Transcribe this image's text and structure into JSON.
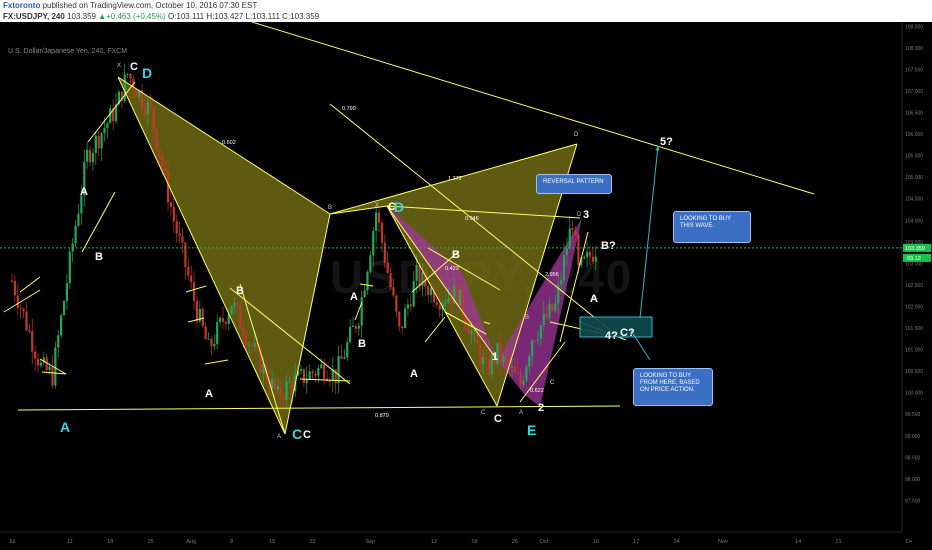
{
  "header": {
    "author": "Fxtoronto",
    "published": "published on TradingView.com, October 10, 2016 07:30 EST",
    "symbol": "FX:USDJPY, 240",
    "last": "103.359",
    "change": "▲+0.463 (+0.45%)",
    "open": "O:103.111",
    "high": "H:103.427",
    "low": "L:103.111",
    "close": "C:103.359"
  },
  "chart_title": "U.S. Dollar/Japanese Yen, 240, FXCM",
  "watermark": "USDJPY, 240",
  "colors": {
    "background": "#000000",
    "up_candle": "#26a65b",
    "down_candle": "#c0392b",
    "trendline": "#ffff66",
    "pattern_fill": "#6e6a14",
    "pattern_fill_purple": "#a0369b",
    "price_line": "#19c14a",
    "arrow": "#35b6c8",
    "callout": "#3a6fc4"
  },
  "chart_data": {
    "type": "candlestick",
    "title": "U.S. Dollar/Japanese Yen, 240, FXCM",
    "xlabel": "",
    "ylabel": "",
    "ylim": [
      97.0,
      108.6
    ],
    "yticks": [
      "108.500",
      "108.000",
      "107.500",
      "107.000",
      "106.500",
      "106.000",
      "105.500",
      "105.000",
      "104.500",
      "104.000",
      "103.500",
      "103.000",
      "102.500",
      "102.000",
      "101.500",
      "101.000",
      "100.500",
      "100.000",
      "99.500",
      "99.000",
      "98.500",
      "98.000",
      "97.500"
    ],
    "xticks": [
      "Jul",
      "11",
      "18",
      "25",
      "Aug",
      "8",
      "15",
      "22",
      "Sep",
      "12",
      "19",
      "26",
      "Oct",
      "10",
      "17",
      "24",
      "Nov",
      "14",
      "21"
    ],
    "current_price": 103.359,
    "price_path": [
      {
        "date": "Jul 1",
        "price": 102.6
      },
      {
        "date": "Jul 6",
        "price": 100.6
      },
      {
        "date": "Jul 8",
        "price": 100.4
      },
      {
        "date": "Jul 12",
        "price": 103.9
      },
      {
        "date": "Jul 14",
        "price": 105.5
      },
      {
        "date": "Jul 19",
        "price": 106.6
      },
      {
        "date": "Jul 21",
        "price": 107.4
      },
      {
        "date": "Jul 25",
        "price": 106.5
      },
      {
        "date": "Jul 29",
        "price": 104.0
      },
      {
        "date": "Aug 2",
        "price": 101.9
      },
      {
        "date": "Aug 4",
        "price": 101.0
      },
      {
        "date": "Aug 8",
        "price": 102.1
      },
      {
        "date": "Aug 11",
        "price": 101.2
      },
      {
        "date": "Aug 16",
        "price": 99.9
      },
      {
        "date": "Aug 18",
        "price": 100.2
      },
      {
        "date": "Aug 24",
        "price": 100.6
      },
      {
        "date": "Aug 26",
        "price": 100.4
      },
      {
        "date": "Aug 30",
        "price": 101.8
      },
      {
        "date": "Sep 1",
        "price": 103.4
      },
      {
        "date": "Sep 2",
        "price": 104.2
      },
      {
        "date": "Sep 6",
        "price": 101.4
      },
      {
        "date": "Sep 9",
        "price": 102.7
      },
      {
        "date": "Sep 13",
        "price": 102.2
      },
      {
        "date": "Sep 16",
        "price": 102.3
      },
      {
        "date": "Sep 21",
        "price": 100.5
      },
      {
        "date": "Sep 23",
        "price": 100.9
      },
      {
        "date": "Sep 27",
        "price": 100.2
      },
      {
        "date": "Sep 29",
        "price": 101.3
      },
      {
        "date": "Oct 3",
        "price": 102.0
      },
      {
        "date": "Oct 5",
        "price": 103.4
      },
      {
        "date": "Oct 6",
        "price": 104.0
      },
      {
        "date": "Oct 7",
        "price": 102.8
      },
      {
        "date": "Oct 10",
        "price": 103.359
      }
    ],
    "price_labels": [
      "103.359",
      "03.12"
    ],
    "patterns": [
      {
        "name": "pattern-1",
        "points": [
          "X",
          "A",
          "B",
          "C",
          "D"
        ]
      },
      {
        "name": "pattern-2",
        "points": [
          "X",
          "A",
          "B",
          "C",
          "D"
        ]
      },
      {
        "name": "pattern-3",
        "points": [
          "A",
          "B",
          "C",
          "D"
        ]
      }
    ],
    "ratios": [
      "0.602",
      "0.799",
      "0.879",
      "1.372",
      "0.946",
      "0.423",
      "2.956",
      "0.622"
    ],
    "wave_labels": [
      "A",
      "B",
      "C",
      "A",
      "B",
      "C",
      "A",
      "B",
      "C",
      "D",
      "A",
      "B",
      "C",
      "1",
      "2",
      "3",
      "A",
      "B?",
      "4?",
      "C?",
      "5?",
      "E",
      "D"
    ]
  },
  "callouts": {
    "reversal": "REVERSAL PATTERN",
    "buy_wave": "LOOKING TO BUY THIS WAVE.",
    "buy_here": "LOOKING TO BUY FROM HERE, BASED ON PRICE ACTION."
  }
}
